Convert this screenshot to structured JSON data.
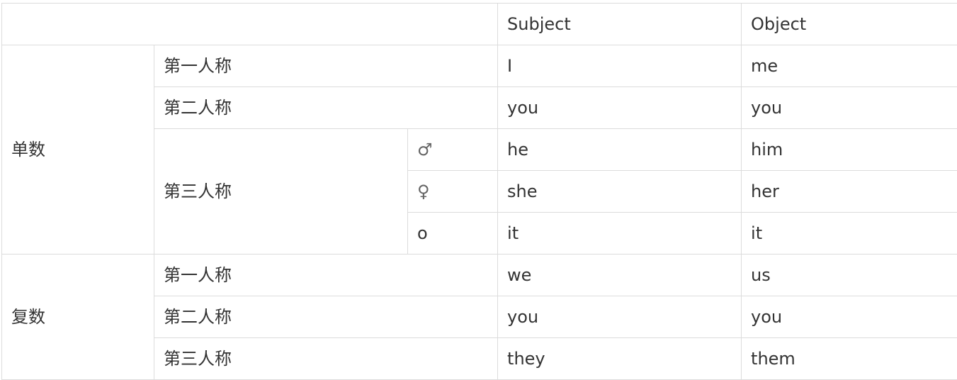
{
  "header": {
    "corner": "",
    "subject": "Subject",
    "object": "Object"
  },
  "singular": {
    "label": "单数",
    "first": {
      "person": "第一人称",
      "subject": "I",
      "object": "me"
    },
    "second": {
      "person": "第二人称",
      "subject": "you",
      "object": "you"
    },
    "third": {
      "person": "第三人称",
      "rows": [
        {
          "gender": "♂",
          "subject": "he",
          "object": "him"
        },
        {
          "gender": "♀",
          "subject": "she",
          "object": "her"
        },
        {
          "gender": "o",
          "subject": "it",
          "object": "it"
        }
      ]
    }
  },
  "plural": {
    "label": "复数",
    "first": {
      "person": "第一人称",
      "subject": "we",
      "object": "us"
    },
    "second": {
      "person": "第二人称",
      "subject": "you",
      "object": "you"
    },
    "third": {
      "person": "第三人称",
      "subject": "they",
      "object": "them"
    }
  }
}
